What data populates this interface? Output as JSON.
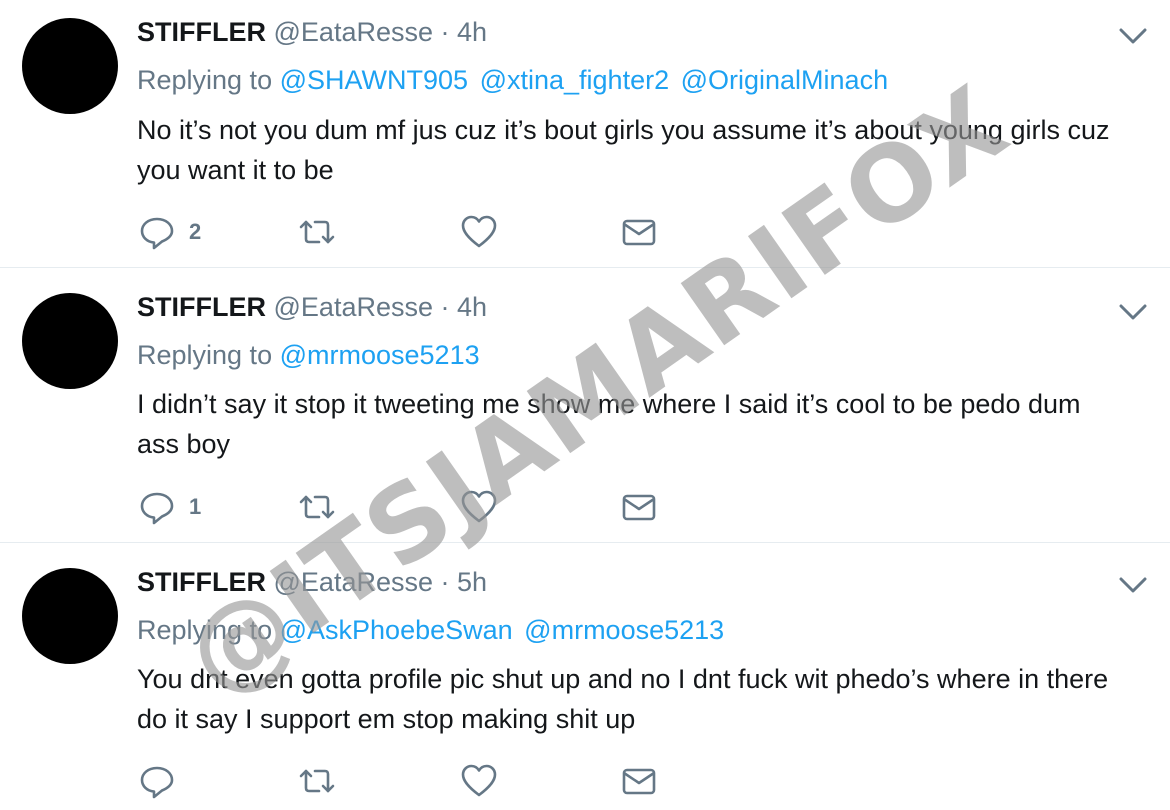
{
  "colors": {
    "name": "#14171a",
    "secondary": "#657786",
    "link": "#1da1f2",
    "divider": "#e6ecf0",
    "avatar": "#000000"
  },
  "watermark": "@ITSJAMARIFOX",
  "tweets": [
    {
      "name": "STIFFLER",
      "handle": "@EataResse",
      "dot": "·",
      "time": "4h",
      "replying_label": "Replying to",
      "mentions": [
        "@SHAWNT905",
        "@xtina_fighter2",
        "@OriginalMinach"
      ],
      "text": "No it’s not you dum mf jus cuz it’s bout girls you assume it’s about young girls cuz you want it to be",
      "reply_count": "2",
      "icons": [
        "reply-icon",
        "retweet-icon",
        "like-icon",
        "message-icon",
        "chevron-down-icon"
      ]
    },
    {
      "name": "STIFFLER",
      "handle": "@EataResse",
      "dot": "·",
      "time": "4h",
      "replying_label": "Replying to",
      "mentions": [
        "@mrmoose5213"
      ],
      "text": "I didn’t say it stop it tweeting me show me where I said it’s cool to be pedo dum ass boy",
      "reply_count": "1",
      "icons": [
        "reply-icon",
        "retweet-icon",
        "like-icon",
        "message-icon",
        "chevron-down-icon"
      ]
    },
    {
      "name": "STIFFLER",
      "handle": "@EataResse",
      "dot": "·",
      "time": "5h",
      "replying_label": "Replying to",
      "mentions": [
        "@AskPhoebeSwan",
        "@mrmoose5213"
      ],
      "text": "You dnt even gotta profile pic shut up and no I dnt fuck wit phedo’s where in there do it say I support em stop making shit up",
      "reply_count": "",
      "icons": [
        "reply-icon",
        "retweet-icon",
        "like-icon",
        "message-icon",
        "chevron-down-icon"
      ]
    }
  ]
}
